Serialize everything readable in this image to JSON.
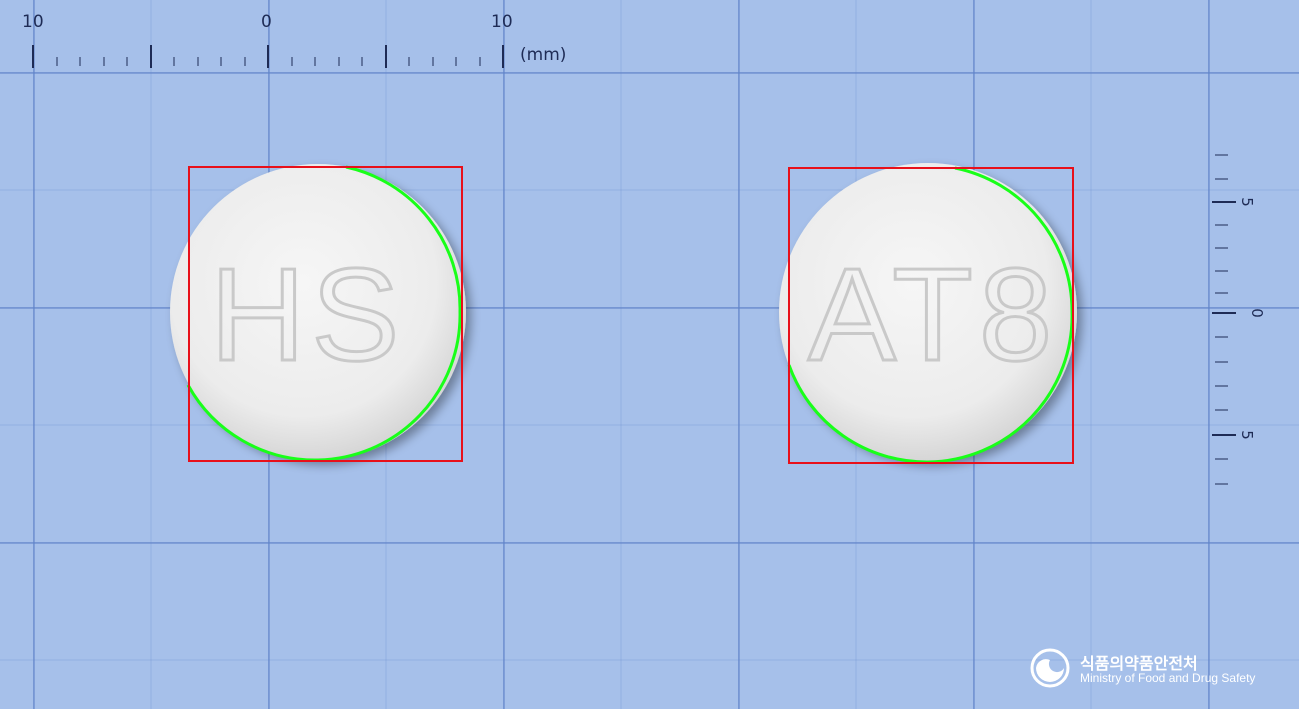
{
  "ruler_top": {
    "labels": [
      "10",
      "0",
      "10"
    ],
    "unit": "(mm)"
  },
  "ruler_right": {
    "labels": [
      "5",
      "0",
      "5"
    ]
  },
  "pills": [
    {
      "imprint": "HS"
    },
    {
      "imprint": "AT8"
    }
  ],
  "colors": {
    "background": "#a6c0ea",
    "bounding_box": "#e8101a",
    "contour": "#19ff19",
    "pill": "#f1f1f1"
  },
  "logo": {
    "name_ko": "식품의약품안전처",
    "name_en": "Ministry of Food and Drug Safety",
    "icon": "mfds-emblem-icon"
  }
}
